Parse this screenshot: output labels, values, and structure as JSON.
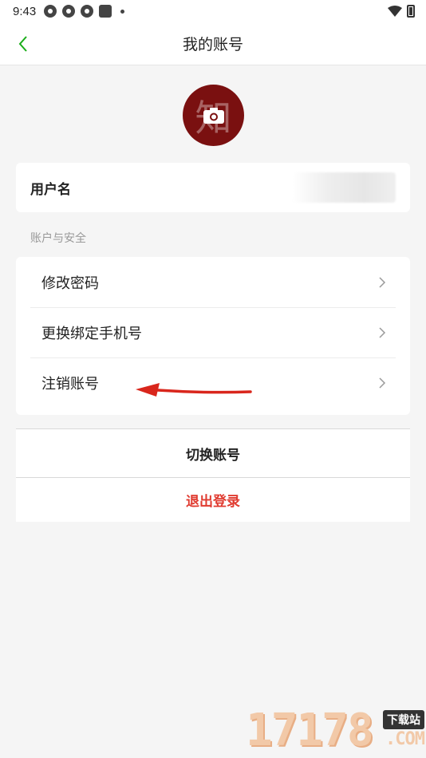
{
  "status_bar": {
    "time": "9:43",
    "left_icons": [
      "app-icon",
      "app-icon",
      "app-icon",
      "square-icon",
      "dot-icon"
    ],
    "right_icons": [
      "wifi-icon",
      "battery-icon"
    ]
  },
  "header": {
    "title": "我的账号",
    "back_icon": "chevron-left-icon",
    "accent_color": "#1aad19"
  },
  "avatar": {
    "icon": "camera-icon",
    "background": "#7a1010"
  },
  "username": {
    "label": "用户名"
  },
  "security": {
    "section_label": "账户与安全",
    "items": [
      {
        "label": "修改密码",
        "icon": "chevron-right-icon"
      },
      {
        "label": "更换绑定手机号",
        "icon": "chevron-right-icon"
      },
      {
        "label": "注销账号",
        "icon": "chevron-right-icon"
      }
    ]
  },
  "actions": {
    "switch_label": "切换账号",
    "logout_label": "退出登录",
    "logout_color": "#e03b30"
  },
  "annotation": {
    "icon": "red-arrow-icon",
    "color": "#d9261c"
  },
  "watermark": {
    "number": "17178",
    "badge": "下载站",
    "suffix": ".COM"
  }
}
